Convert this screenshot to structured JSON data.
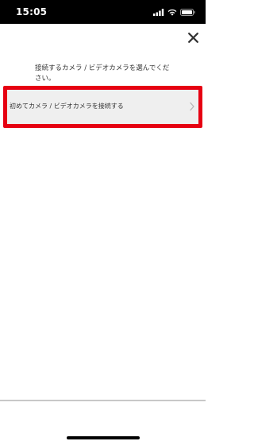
{
  "status_bar": {
    "time": "15:05",
    "icons": [
      "signal-icon",
      "wifi-icon",
      "battery-icon"
    ]
  },
  "header": {
    "close_icon": "close-icon"
  },
  "main": {
    "instruction": "接続するカメラ / ビデオカメラを選んでください。",
    "options": [
      {
        "label": "初めてカメラ / ビデオカメラを接続する",
        "icon": "chevron-right-icon"
      }
    ]
  },
  "colors": {
    "highlight": "#e60012",
    "option_background": "#efefef",
    "status_bar": "#000000"
  }
}
